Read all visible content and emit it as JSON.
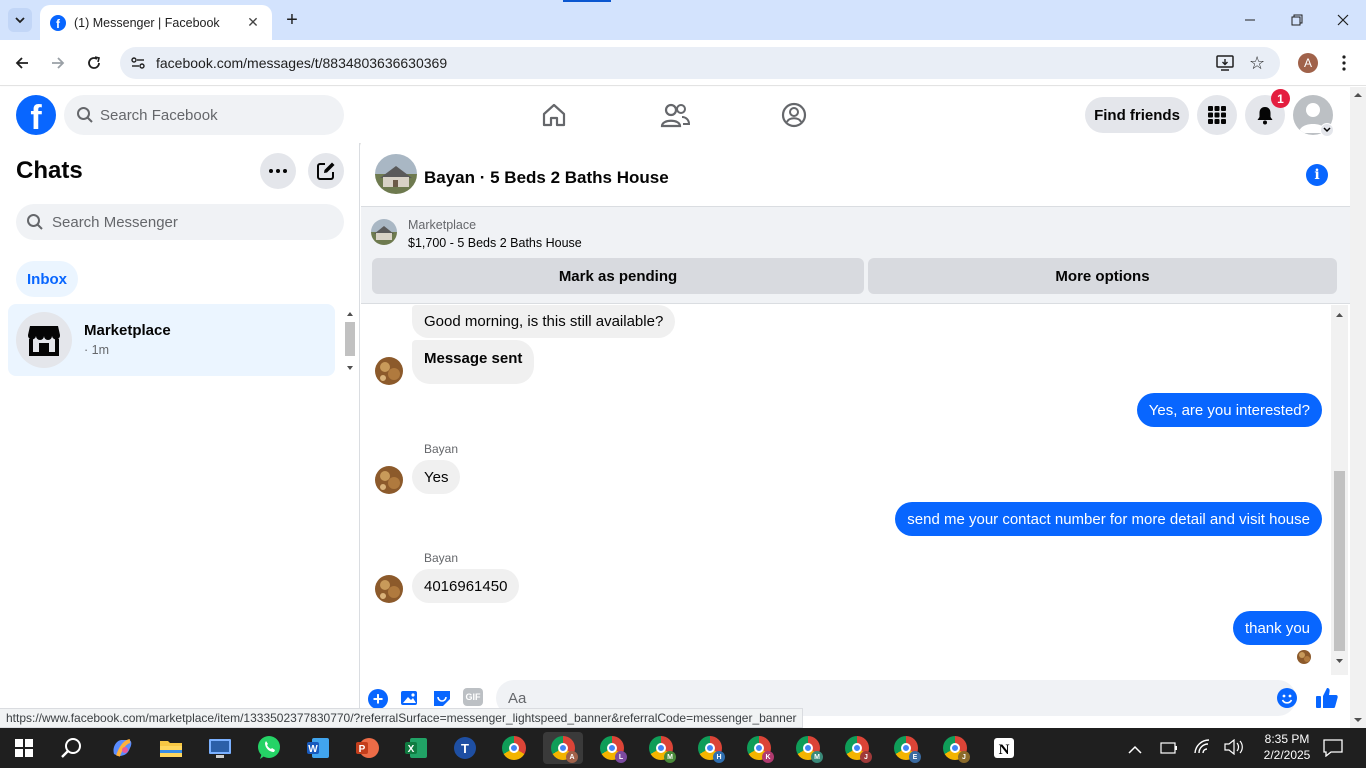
{
  "browser": {
    "tab_title": "(1) Messenger | Facebook",
    "url": "facebook.com/messages/t/8834803636630369",
    "profile_initial": "A",
    "status_url": "https://www.facebook.com/marketplace/item/1333502377830770/?referralSurface=messenger_lightspeed_banner&referralCode=messenger_banner"
  },
  "header": {
    "logo": "f",
    "search_placeholder": "Search Facebook",
    "find_friends": "Find friends",
    "notification_count": "1"
  },
  "sidebar": {
    "title": "Chats",
    "search_placeholder": "Search Messenger",
    "inbox_label": "Inbox",
    "chats": [
      {
        "name": "Marketplace",
        "time": "· 1m"
      }
    ]
  },
  "conversation": {
    "title": "Bayan · 5 Beds 2 Baths House",
    "banner": {
      "label": "Marketplace",
      "listing": "$1,700 - 5 Beds 2 Baths House",
      "mark_pending": "Mark as pending",
      "more_options": "More options"
    },
    "messages": [
      {
        "from": "them",
        "text": "Good morning, is this still available?"
      },
      {
        "from": "them",
        "text": "Message sent"
      },
      {
        "from": "me",
        "text": "Yes, are you interested?"
      },
      {
        "from": "them",
        "sender": "Bayan",
        "text": "Yes"
      },
      {
        "from": "me",
        "text": "send me your contact number for more detail and visit house"
      },
      {
        "from": "them",
        "sender": "Bayan",
        "text": "4016961450"
      },
      {
        "from": "me",
        "text": "thank you"
      }
    ],
    "composer_placeholder": "Aa"
  },
  "taskbar": {
    "time": "8:35 PM",
    "date": "2/2/2025",
    "chrome_profiles": [
      "",
      "A",
      "L",
      "M",
      "H",
      "K",
      "M",
      "J",
      "E",
      "J"
    ]
  },
  "colors": {
    "facebook_blue": "#0866ff",
    "selected_chat": "#ebf5ff",
    "badge_red": "#e41e3f"
  }
}
